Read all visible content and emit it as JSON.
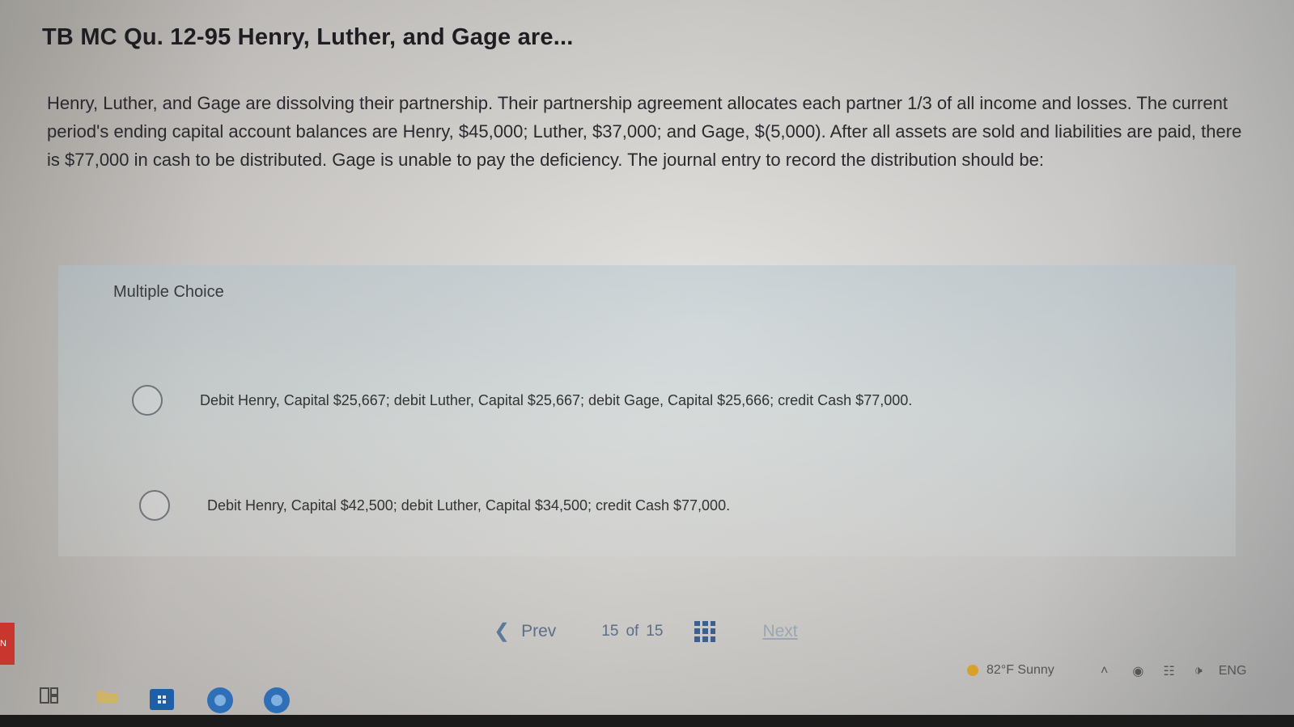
{
  "question": {
    "title": "TB MC Qu. 12-95 Henry, Luther, and Gage are...",
    "prompt": "Henry, Luther, and Gage are dissolving their partnership. Their partnership agreement allocates each partner 1/3 of all income and losses. The current period's ending capital account balances are Henry, $45,000; Luther, $37,000; and Gage, $(5,000). After all assets are sold and liabilities are paid, there is $77,000 in cash to be distributed. Gage is unable to pay the deficiency. The journal entry to record the distribution should be:",
    "choices_label": "Multiple Choice",
    "options": [
      {
        "text": "Debit Henry, Capital $25,667; debit Luther, Capital $25,667; debit Gage, Capital $25,666; credit Cash $77,000."
      },
      {
        "text": "Debit Henry, Capital $42,500; debit Luther, Capital $34,500; credit Cash $77,000."
      }
    ]
  },
  "nav": {
    "prev_label": "Prev",
    "current": "15",
    "of_label": "of",
    "total": "15",
    "next_label": "Next"
  },
  "taskbar": {
    "weather": "82°F Sunny",
    "language": "ENG",
    "side_tab": "N"
  },
  "colors": {
    "accent": "#3e5f8c",
    "taskbar_icon_blue": "#1f5fa8",
    "edge_tab": "#c9362d"
  }
}
